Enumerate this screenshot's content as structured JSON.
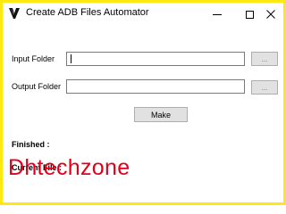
{
  "window": {
    "title": "Create ADB Files Automator",
    "icon": "app-logo-icon"
  },
  "form": {
    "input_label": "Input Folder",
    "input_value": "",
    "input_browse": "...",
    "output_label": "Output Folder",
    "output_value": "",
    "output_browse": "...",
    "make_label": "Make",
    "finished_label": "Finished :",
    "current_file_label": "Current File :"
  },
  "watermark": "Dhtechzone",
  "colors": {
    "frame": "#fde910",
    "watermark": "#e0001b"
  }
}
